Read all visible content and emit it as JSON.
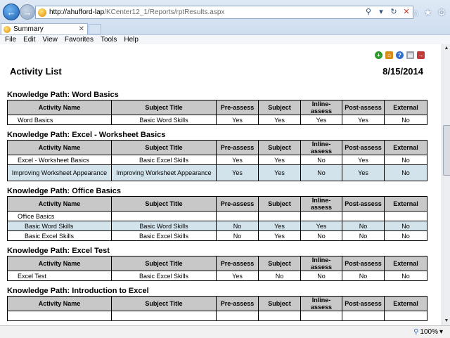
{
  "browser": {
    "address_host": "http://ahufford-lap",
    "address_path": "/KCenter12_1/Reports/rptResults.aspx",
    "tab_label": "Summary",
    "menu": [
      "File",
      "Edit",
      "View",
      "Favorites",
      "Tools",
      "Help"
    ],
    "zoom": "100%"
  },
  "page": {
    "title": "Activity List",
    "date": "8/15/2014"
  },
  "headers": [
    "Activity Name",
    "Subject Title",
    "Pre-assess",
    "Subject",
    "Inline-assess",
    "Post-assess",
    "External"
  ],
  "paths": [
    {
      "title": "Knowledge Path: Word Basics",
      "rows": [
        {
          "cells": [
            "Word Basics",
            "Basic Word Skills",
            "Yes",
            "Yes",
            "Yes",
            "Yes",
            "No"
          ]
        }
      ]
    },
    {
      "title": "Knowledge Path: Excel - Worksheet Basics",
      "rows": [
        {
          "cells": [
            "Excel - Worksheet Basics",
            "Basic Excel Skills",
            "Yes",
            "Yes",
            "No",
            "Yes",
            "No"
          ]
        },
        {
          "cells": [
            "Improving Worksheet Appearance",
            "Improving Worksheet Appearance",
            "Yes",
            "Yes",
            "No",
            "Yes",
            "No"
          ]
        }
      ]
    },
    {
      "title": "Knowledge Path: Office Basics",
      "rows": [
        {
          "cells": [
            "Office Basics",
            "",
            "",
            "",
            "",
            "",
            ""
          ]
        },
        {
          "cells": [
            "Basic Word Skills",
            "Basic Word Skills",
            "No",
            "Yes",
            "Yes",
            "No",
            "No"
          ]
        },
        {
          "cells": [
            "Basic Excel Skills",
            "Basic Excel Skills",
            "No",
            "Yes",
            "No",
            "No",
            "No"
          ]
        }
      ]
    },
    {
      "title": "Knowledge Path: Excel Test",
      "rows": [
        {
          "cells": [
            "Excel Test",
            "Basic Excel Skills",
            "Yes",
            "No",
            "No",
            "No",
            "No"
          ]
        }
      ]
    },
    {
      "title": "Knowledge Path: Introduction to Excel",
      "rows": [
        {
          "cells": [
            "",
            "",
            "",
            "",
            "",
            "",
            ""
          ]
        }
      ]
    }
  ],
  "icons": {
    "add": "add-icon",
    "home": "home-icon",
    "help": "help-icon",
    "print": "print-icon",
    "exit": "exit-icon"
  }
}
